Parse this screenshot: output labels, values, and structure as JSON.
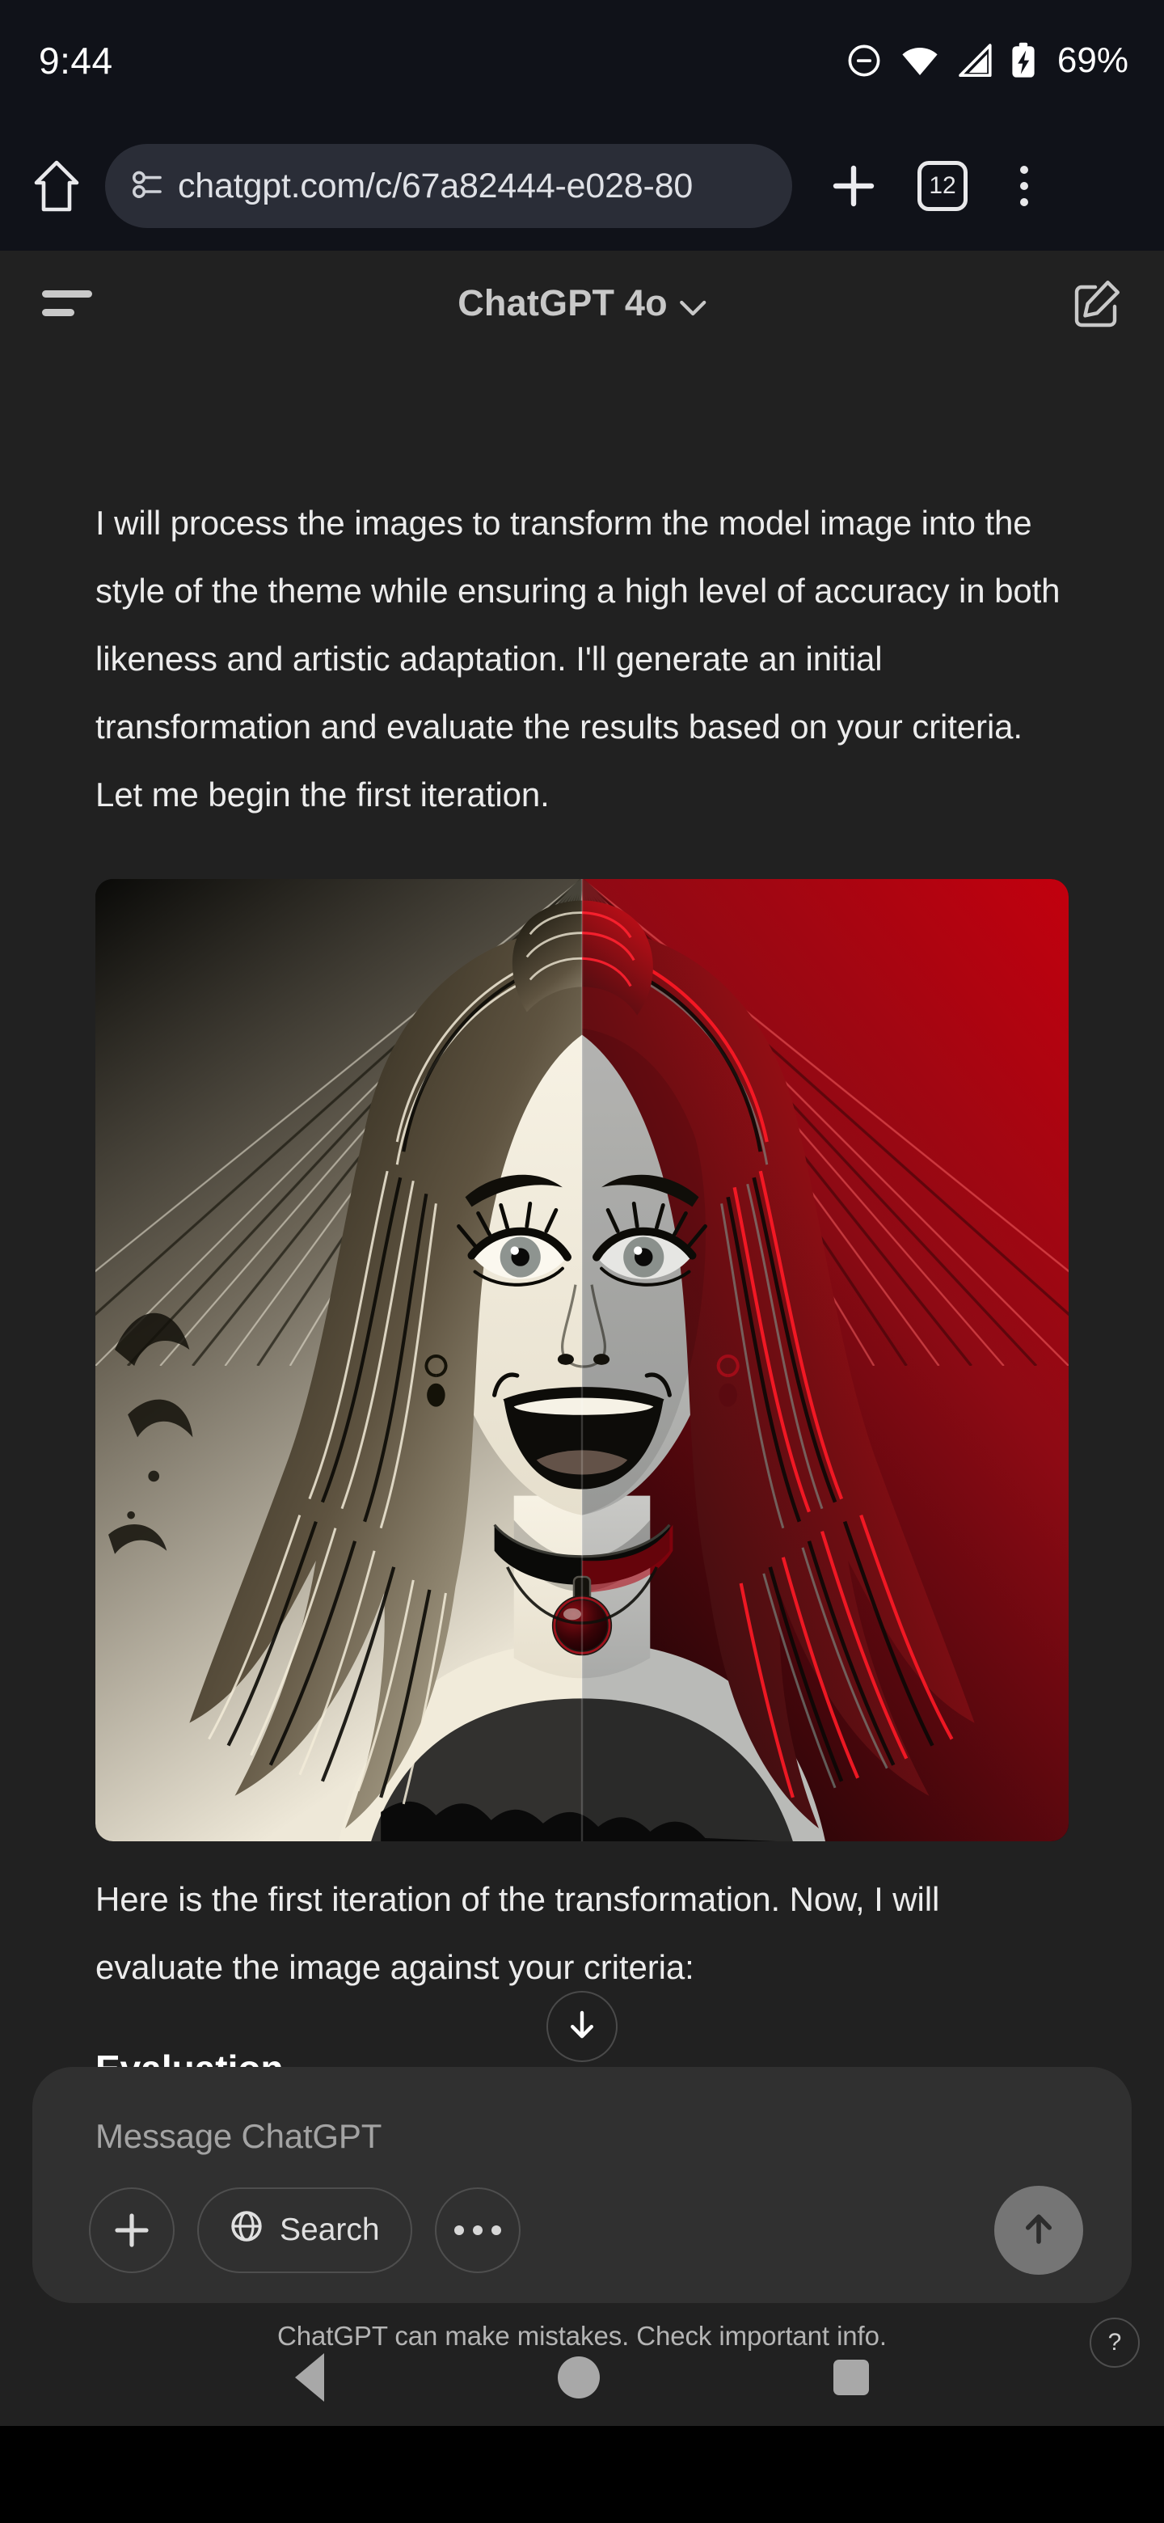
{
  "statusbar": {
    "time": "9:44",
    "battery_percent": "69%",
    "icons": [
      "do-not-disturb-icon",
      "wifi-icon",
      "cellular-signal-icon",
      "battery-charging-icon"
    ]
  },
  "browser": {
    "home_icon": "home-icon",
    "site_settings_icon": "site-settings-icon",
    "url": "chatgpt.com/c/67a82444-e028-80",
    "new_tab_icon": "plus-icon",
    "tab_count": "12",
    "menu_icon": "three-dot-menu-icon"
  },
  "app_header": {
    "menu_icon": "hamburger-menu-icon",
    "title": "ChatGPT 4o",
    "chevron_icon": "chevron-down-icon",
    "compose_icon": "new-chat-compose-icon"
  },
  "conversation": {
    "paragraph_1": "I will process the images to transform the model image into the style of the theme while ensuring a high level of accuracy in both likeness and artistic adaptation. I'll generate an initial transformation and evaluate the results based on your criteria. Let me begin the first iteration.",
    "image_alt": "Comic-style split portrait of a smiling woman, monochrome ink-line left half and red-toned right half with radiating speed lines",
    "paragraph_2": "Here is the first iteration of the transformation. Now, I will evaluate the image against your criteria:",
    "heading": "Evaluation",
    "scroll_down_icon": "arrow-down-icon"
  },
  "composer": {
    "placeholder": "Message ChatGPT",
    "add_icon": "plus-icon",
    "search_label": "Search",
    "search_icon": "globe-icon",
    "more_icon": "ellipsis-icon",
    "send_icon": "arrow-up-icon"
  },
  "footer": {
    "disclaimer": "ChatGPT can make mistakes. Check important info.",
    "help_label": "?"
  },
  "navbar": {
    "back_icon": "nav-back-icon",
    "home_icon": "nav-home-icon",
    "recents_icon": "nav-recents-icon"
  },
  "colors": {
    "status_bg": "#101219",
    "app_bg": "#212121",
    "composer_bg": "#303030",
    "send_btn_bg": "#757575",
    "accent_red": "#c8102e"
  }
}
